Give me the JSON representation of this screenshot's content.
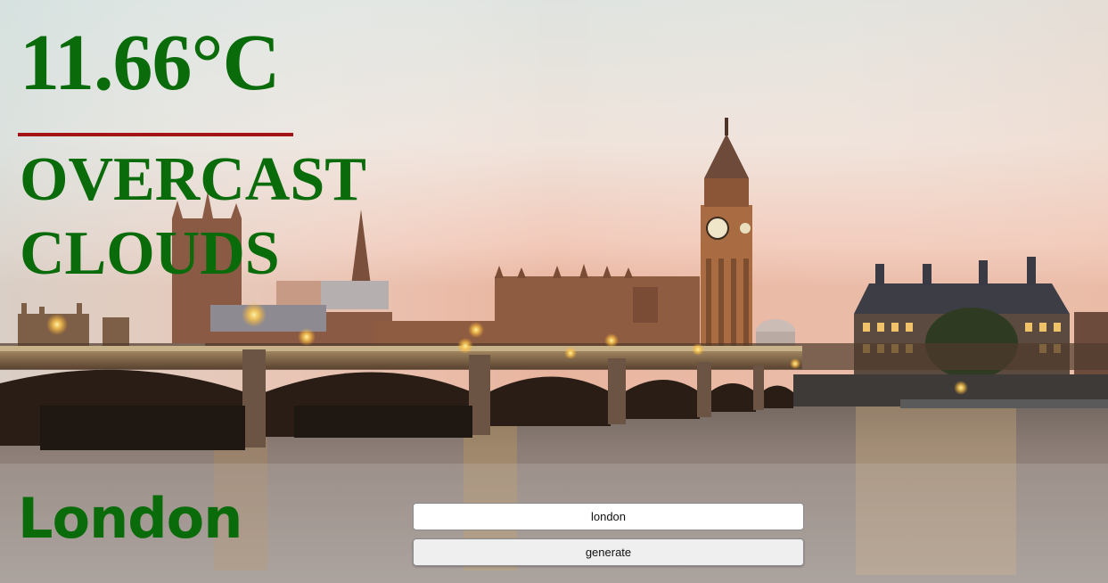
{
  "weather": {
    "temperature": "11.66°C",
    "description": "overcast clouds",
    "city": "London"
  },
  "form": {
    "city_input_value": "london",
    "generate_label": "generate"
  },
  "colors": {
    "text_green": "#0a6b0a",
    "divider_red": "#a31414"
  },
  "background": {
    "scene": "london-westminster-photo"
  }
}
